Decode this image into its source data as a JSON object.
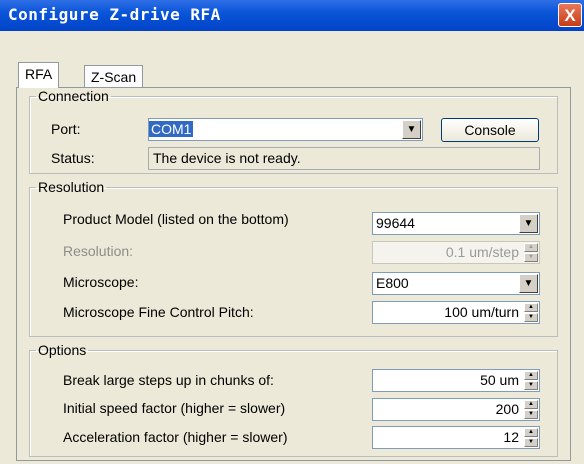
{
  "window": {
    "title": "Configure Z-drive RFA",
    "close_glyph": "X"
  },
  "tabs": [
    {
      "label": "RFA",
      "active": true
    },
    {
      "label": "Z-Scan",
      "active": false
    }
  ],
  "connection": {
    "legend": "Connection",
    "port_label": "Port:",
    "port_value": "COM1",
    "console_label": "Console",
    "status_label": "Status:",
    "status_value": "The device is not ready."
  },
  "resolution": {
    "legend": "Resolution",
    "product_model_label": "Product Model  (listed on the  bottom)",
    "product_model_value": "99644",
    "resolution_label": "Resolution:",
    "resolution_value": "0.1 um/step",
    "microscope_label": "Microscope:",
    "microscope_value": "E800",
    "fine_pitch_label": "Microscope Fine Control Pitch:",
    "fine_pitch_value": "100 um/turn"
  },
  "options": {
    "legend": "Options",
    "break_label": "Break large steps up in chunks of:",
    "break_value": "50 um",
    "speed_label": "Initial speed factor (higher = slower)",
    "speed_value": "200",
    "accel_label": "Acceleration factor (higher = slower)",
    "accel_value": "12"
  },
  "icons": {
    "dropdown": "chevron-down-icon",
    "spin": "spin-arrows-icon",
    "close": "close-icon"
  }
}
